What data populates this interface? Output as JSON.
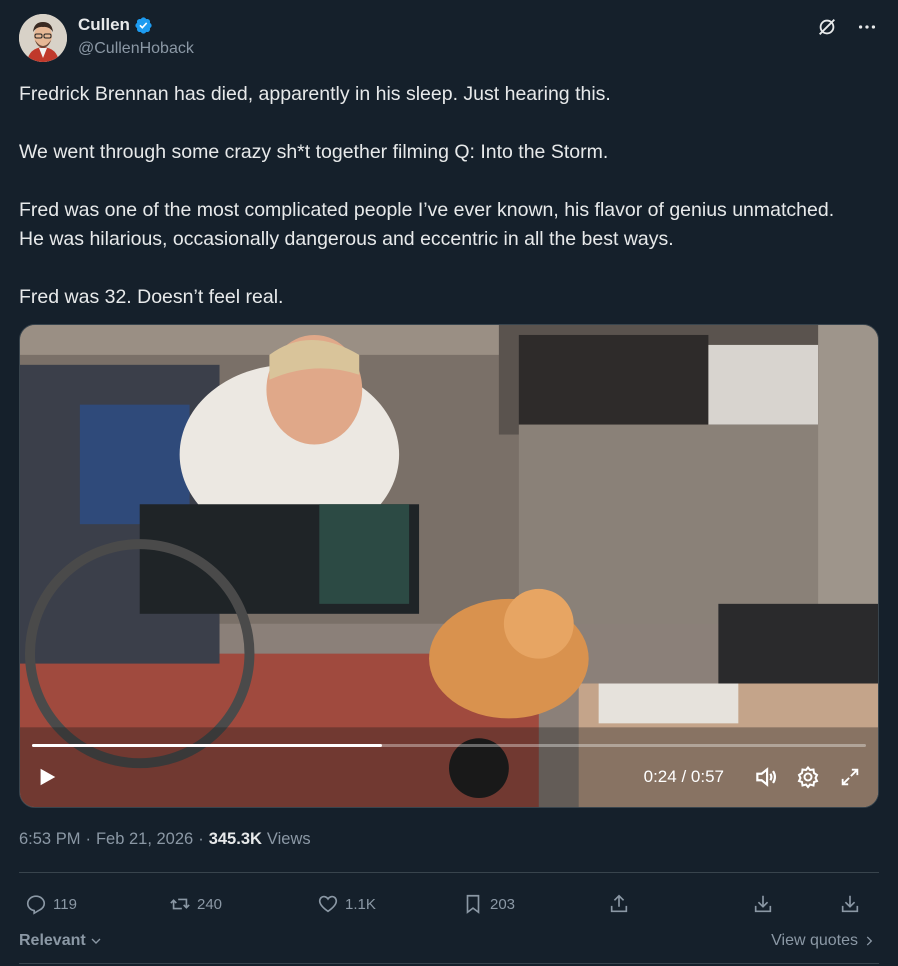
{
  "author": {
    "name": "Cullen",
    "handle": "@CullenHoback",
    "verified": true
  },
  "tweet": {
    "paragraphs": [
      [
        "Fredrick Brennan has died, apparently in his sleep. Just hearing this."
      ],
      [
        "We went through some crazy sh*t together filming Q: Into the Storm."
      ],
      [
        "Fred was one of the most complicated people I’ve ever known, his flavor of genius unmatched.",
        "He was hilarious, occasionally dangerous and eccentric in all the best ways."
      ],
      [
        "Fred was 32. Doesn’t feel real."
      ]
    ]
  },
  "video": {
    "current_time": "0:24",
    "separator": "/",
    "duration": "0:57",
    "progress_fraction": 0.42
  },
  "meta": {
    "time": "6:53 PM",
    "dot1": "·",
    "date": "Feb 21, 2026",
    "dot2": "·",
    "views_count": "345.3K",
    "views_label": "Views"
  },
  "actions": {
    "replies": "119",
    "reposts": "240",
    "likes": "1.1K",
    "bookmarks": "203"
  },
  "footer": {
    "relevant": "Relevant",
    "view_quotes": "View quotes"
  },
  "colors": {
    "background": "#15202b",
    "text_primary": "#e7e9ea",
    "text_secondary": "#8b98a5",
    "verified_blue": "#1d9bf0",
    "border": "#38444d"
  },
  "icons": [
    "verified-badge-icon",
    "grok-icon",
    "more-icon",
    "play-icon",
    "volume-icon",
    "settings-icon",
    "fullscreen-icon",
    "reply-icon",
    "repost-icon",
    "like-icon",
    "bookmark-icon",
    "share-icon",
    "download-icon",
    "chevron-down-icon",
    "chevron-right-icon"
  ]
}
